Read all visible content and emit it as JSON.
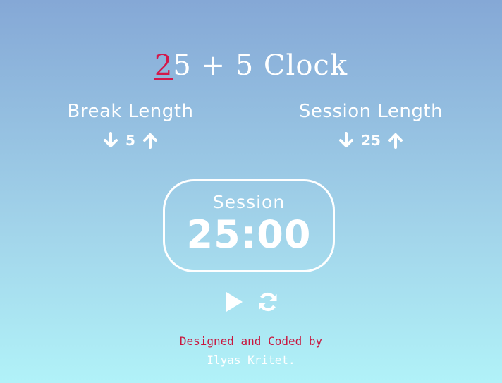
{
  "title": {
    "accent": "2",
    "rest": "5 + 5 Clock"
  },
  "break": {
    "label": "Break Length",
    "value": "5"
  },
  "session": {
    "label": "Session Length",
    "value": "25"
  },
  "timer": {
    "label": "Session",
    "time": "25:00"
  },
  "controls": {
    "play_icon": "play-icon",
    "reset_icon": "refresh-icon"
  },
  "footer": {
    "credit": "Designed and Coded by",
    "author": "Ilyas Kritet."
  },
  "colors": {
    "accent": "#d4184a",
    "gradient_top": "#85a8d6",
    "gradient_bottom": "#b1f2f8",
    "text": "#ffffff"
  }
}
